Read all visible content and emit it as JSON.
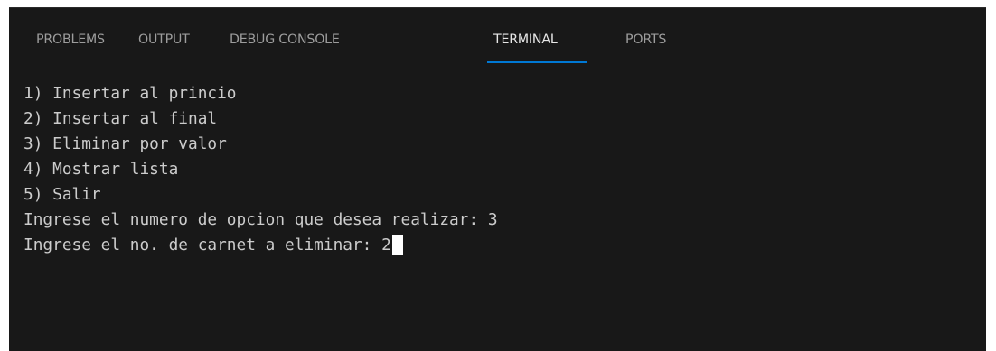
{
  "tabs": [
    {
      "label": "PROBLEMS",
      "active": false
    },
    {
      "label": "OUTPUT",
      "active": false
    },
    {
      "label": "DEBUG CONSOLE",
      "active": false
    },
    {
      "label": "TERMINAL",
      "active": true
    },
    {
      "label": "PORTS",
      "active": false
    }
  ],
  "terminal": {
    "lines": [
      "1) Insertar al princio",
      "2) Insertar al final",
      "3) Eliminar por valor",
      "4) Mostrar lista",
      "5) Salir",
      "Ingrese el numero de opcion que desea realizar: 3",
      "Ingrese el no. de carnet a eliminar: 2"
    ]
  },
  "colors": {
    "panel_background": "#181818",
    "active_tab_underline": "#0078d4",
    "terminal_text": "#cccccc",
    "inactive_tab_text": "#9d9d9d",
    "active_tab_text": "#e7e7e7"
  }
}
